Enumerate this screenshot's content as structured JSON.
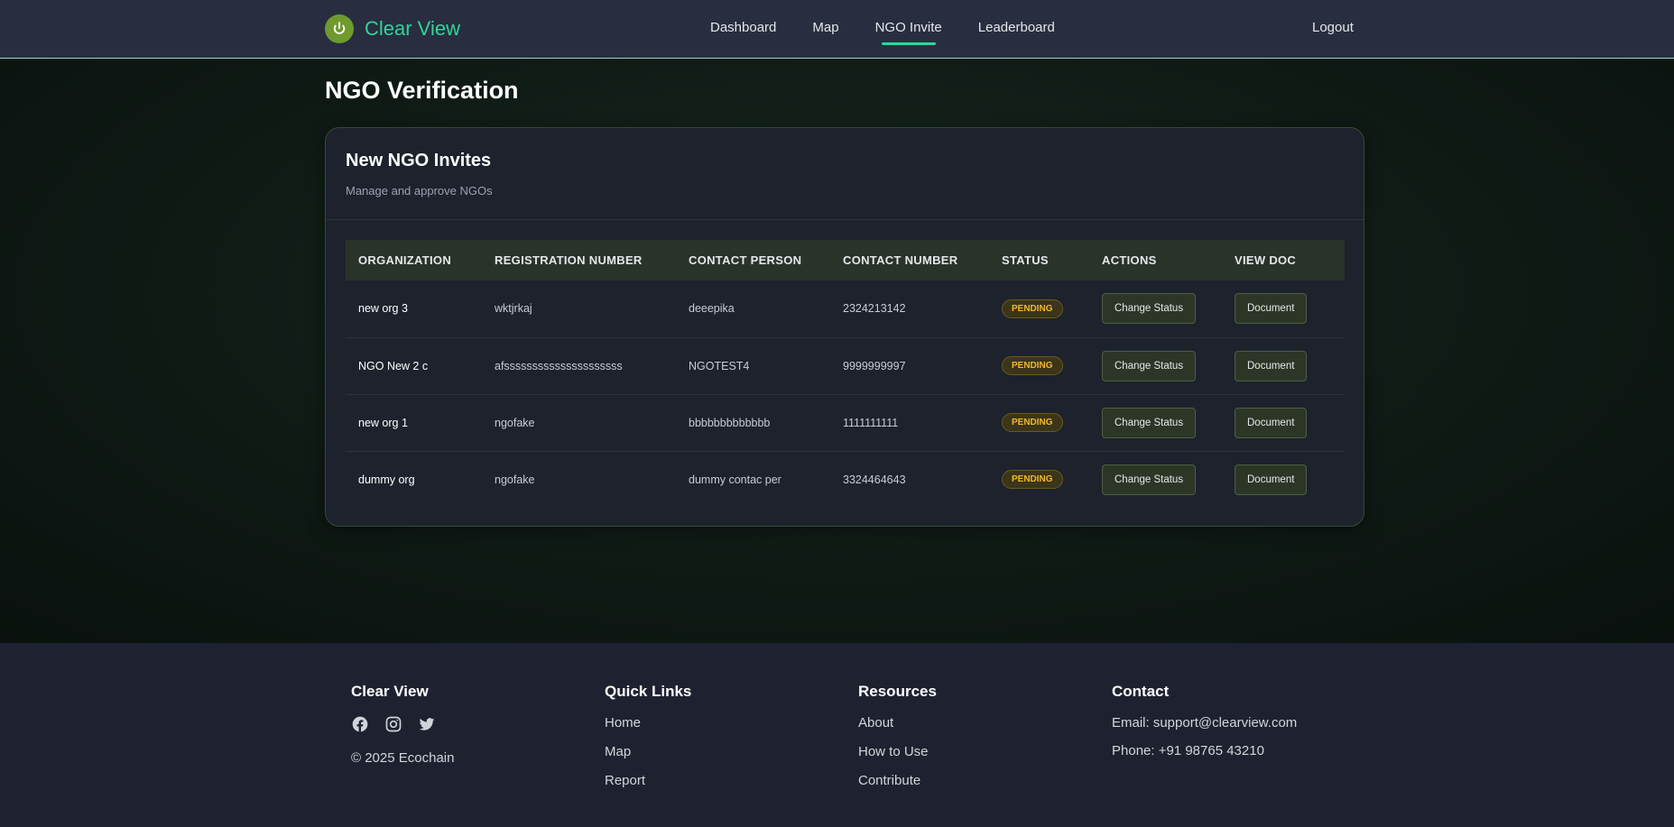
{
  "brand": {
    "name": "Clear View"
  },
  "nav": {
    "items": [
      {
        "label": "Dashboard"
      },
      {
        "label": "Map"
      },
      {
        "label": "NGO Invite"
      },
      {
        "label": "Leaderboard"
      }
    ],
    "active": "NGO Invite",
    "logout": "Logout"
  },
  "page": {
    "title": "NGO Verification"
  },
  "card": {
    "title": "New NGO Invites",
    "subtitle": "Manage and approve NGOs"
  },
  "table": {
    "headers": [
      "ORGANIZATION",
      "REGISTRATION NUMBER",
      "CONTACT PERSON",
      "CONTACT NUMBER",
      "STATUS",
      "ACTIONS",
      "VIEW DOC"
    ],
    "rows": [
      {
        "organization": "new org 3",
        "registration": "wktjrkaj",
        "contact_person": "deeepika",
        "contact_number": "2324213142",
        "status": "PENDING",
        "action": "Change Status",
        "doc": "Document"
      },
      {
        "organization": "NGO New 2 c",
        "registration": "afsssssssssssssssssssss",
        "contact_person": "NGOTEST4",
        "contact_number": "9999999997",
        "status": "PENDING",
        "action": "Change Status",
        "doc": "Document"
      },
      {
        "organization": "new org 1",
        "registration": "ngofake",
        "contact_person": "bbbbbbbbbbbbb",
        "contact_number": "1111111111",
        "status": "PENDING",
        "action": "Change Status",
        "doc": "Document"
      },
      {
        "organization": "dummy org",
        "registration": "ngofake",
        "contact_person": "dummy contac per",
        "contact_number": "3324464643",
        "status": "PENDING",
        "action": "Change Status",
        "doc": "Document"
      }
    ]
  },
  "footer": {
    "brand": {
      "title": "Clear View",
      "socials": [
        "facebook-icon",
        "instagram-icon",
        "twitter-icon"
      ],
      "copyright": "© 2025 Ecochain"
    },
    "quick_links": {
      "title": "Quick Links",
      "items": [
        "Home",
        "Map",
        "Report"
      ]
    },
    "resources": {
      "title": "Resources",
      "items": [
        "About",
        "How to Use",
        "Contribute"
      ]
    },
    "contact": {
      "title": "Contact",
      "email": "Email: support@clearview.com",
      "phone": "Phone: +91 98765 43210"
    }
  },
  "colors": {
    "accent": "#34d399",
    "badge": "#f2b82e"
  }
}
